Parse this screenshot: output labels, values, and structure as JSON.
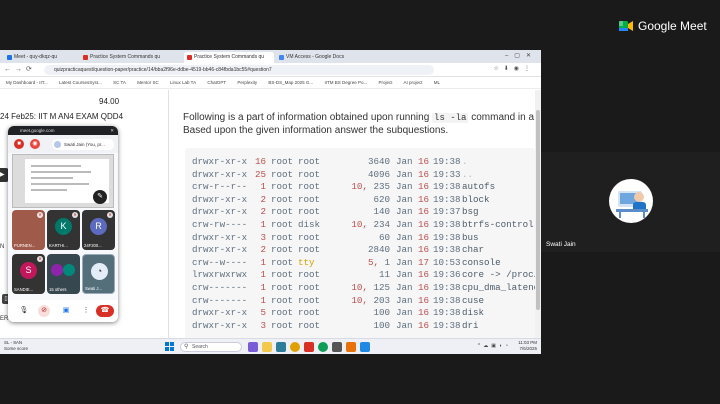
{
  "meet": {
    "app_name": "Google Meet",
    "participant_name": "Swati Jain"
  },
  "browser": {
    "tabs": [
      {
        "label": "Meet - quy-dkqz-qu",
        "color": "#1a73e8"
      },
      {
        "label": "Practice System Commands qu",
        "color": "#d93025"
      },
      {
        "label": "Practice System Commands qu",
        "color": "#d93025",
        "active": true
      },
      {
        "label": "VM Access - Google Docs",
        "color": "#4285f4"
      }
    ],
    "url": "quizpracticaquest/question-paper/practice/14/bba2f96e-ddbe-4519-bb46-c84fbda1bc55#question7",
    "bookmarks": [
      "My Dashboard - IIT...",
      "Latest CoursesSyst...",
      "SC TA",
      "Mentor SC",
      "Linux Lab TA",
      "ChatGPT",
      "Perplexity",
      "BS-DS_Map 2025 G...",
      "IITM BS Degree Po...",
      "Project",
      "AI project",
      "ML"
    ]
  },
  "page": {
    "score": "94.00",
    "exam_title": "24 Feb25: IIT M AN4 EXAM QDD4",
    "side_fragments": [
      "N",
      "ER"
    ],
    "question_line1_prefix": "Following is a part of information obtained upon running",
    "question_code": "ls -la",
    "question_line1_suffix": "command in a",
    "question_line2": "Based upon the given information answer the subquestions.",
    "listing": [
      {
        "perm": "drwxr-xr-x",
        "links": "16",
        "owner": "root",
        "group": "root",
        "major": "",
        "size": "3640",
        "month": "Jan",
        "day": "16",
        "time": "19:38",
        "name": ".",
        "dim": true
      },
      {
        "perm": "drwxr-xr-x",
        "links": "25",
        "owner": "root",
        "group": "root",
        "major": "",
        "size": "4096",
        "month": "Jan",
        "day": "16",
        "time": "19:33",
        "name": "..",
        "dim": true
      },
      {
        "perm": "crw-r--r--",
        "links": "1",
        "owner": "root",
        "group": "root",
        "major": "10,",
        "size": "235",
        "month": "Jan",
        "day": "16",
        "time": "19:38",
        "name": "autofs"
      },
      {
        "perm": "drwxr-xr-x",
        "links": "2",
        "owner": "root",
        "group": "root",
        "major": "",
        "size": "620",
        "month": "Jan",
        "day": "16",
        "time": "19:38",
        "name": "block"
      },
      {
        "perm": "drwxr-xr-x",
        "links": "2",
        "owner": "root",
        "group": "root",
        "major": "",
        "size": "140",
        "month": "Jan",
        "day": "16",
        "time": "19:37",
        "name": "bsg"
      },
      {
        "perm": "crw-rw----",
        "links": "1",
        "owner": "root",
        "group": "disk",
        "major": "10,",
        "size": "234",
        "month": "Jan",
        "day": "16",
        "time": "19:38",
        "name": "btrfs-control"
      },
      {
        "perm": "drwxr-xr-x",
        "links": "3",
        "owner": "root",
        "group": "root",
        "major": "",
        "size": "60",
        "month": "Jan",
        "day": "16",
        "time": "19:38",
        "name": "bus"
      },
      {
        "perm": "drwxr-xr-x",
        "links": "2",
        "owner": "root",
        "group": "root",
        "major": "",
        "size": "2840",
        "day": "16",
        "month": "Jan",
        "time": "19:38",
        "name": "char"
      },
      {
        "perm": "crw--w----",
        "links": "1",
        "owner": "root",
        "group": "tty",
        "major": "5,",
        "size": "1",
        "month": "Jan",
        "day": "17",
        "time": "10:53",
        "name": "console"
      },
      {
        "perm": "lrwxrwxrwx",
        "links": "1",
        "owner": "root",
        "group": "root",
        "major": "",
        "size": "11",
        "month": "Jan",
        "day": "16",
        "time": "19:36",
        "name": "core -> /proc/k"
      },
      {
        "perm": "crw-------",
        "links": "1",
        "owner": "root",
        "group": "root",
        "major": "10,",
        "size": "125",
        "month": "Jan",
        "day": "16",
        "time": "19:38",
        "name": "cpu_dma_latency"
      },
      {
        "perm": "crw-------",
        "links": "1",
        "owner": "root",
        "group": "root",
        "major": "10,",
        "size": "203",
        "month": "Jan",
        "day": "16",
        "time": "19:38",
        "name": "cuse"
      },
      {
        "perm": "drwxr-xr-x",
        "links": "5",
        "owner": "root",
        "group": "root",
        "major": "",
        "size": "100",
        "month": "Jan",
        "day": "16",
        "time": "19:38",
        "name": "disk"
      },
      {
        "perm": "drwxr-xr-x",
        "links": "3",
        "owner": "root",
        "group": "root",
        "major": "",
        "size": "100",
        "month": "Jan",
        "day": "16",
        "time": "19:38",
        "name": "dri"
      }
    ]
  },
  "popup": {
    "window_title": "meet.google.com",
    "presenter": "Swati Jain (You, pr...",
    "tiles": [
      {
        "label": "PURNEN...",
        "initial": "",
        "bg": "#a05a4a"
      },
      {
        "label": "KARTHI...",
        "initial": "K",
        "bg": "#00796b"
      },
      {
        "label": "24F200...",
        "initial": "R",
        "bg": "#5c6bc0"
      },
      {
        "label": "SANDIE...",
        "initial": "S",
        "bg": "#c2185b"
      },
      {
        "label": "15 others",
        "initial": "",
        "bg": "#37474f"
      },
      {
        "label": "Swati J...",
        "initial": "",
        "bg": "#546e7a"
      }
    ]
  },
  "taskbar": {
    "weather_temp": "SL - 8AN",
    "weather_desc": "Some score",
    "search_placeholder": "Search",
    "time": "11:03 PM",
    "date": "7/6/2025"
  },
  "colors": {
    "accent": "#1a73e8",
    "meet_bg": "#1a1a1a",
    "end_call": "#d93025"
  }
}
